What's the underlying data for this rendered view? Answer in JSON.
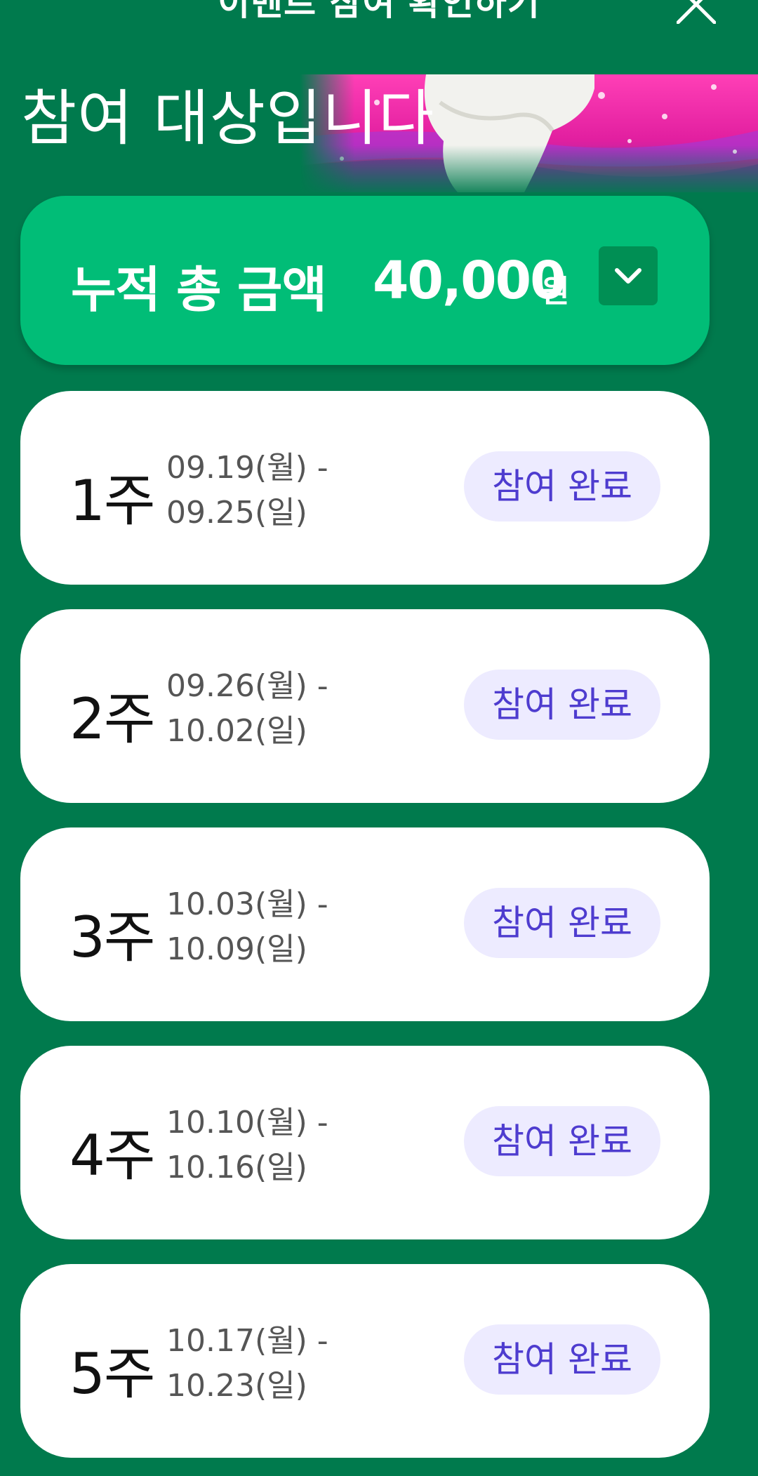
{
  "header": {
    "title": "이벤트 참여 확인하기",
    "subtitle": "참여 대상입니다"
  },
  "total": {
    "label": "누적 총 금액",
    "amount": "40,000",
    "unit": "원"
  },
  "weeks": [
    {
      "label": "1주",
      "start": "09.19(월) -",
      "end": "09.25(일)",
      "status": "참여 완료"
    },
    {
      "label": "2주",
      "start": "09.26(월) -",
      "end": "10.02(일)",
      "status": "참여 완료"
    },
    {
      "label": "3주",
      "start": "10.03(월) -",
      "end": "10.09(일)",
      "status": "참여 완료"
    },
    {
      "label": "4주",
      "start": "10.10(월) -",
      "end": "10.16(일)",
      "status": "참여 완료"
    },
    {
      "label": "5주",
      "start": "10.17(월) -",
      "end": "10.23(일)",
      "status": "참여 완료"
    }
  ],
  "icons": {
    "close": "close-icon",
    "chevron": "chevron-down-icon"
  },
  "colors": {
    "background": "#007A4D",
    "total_card": "#01BD77",
    "toggle": "#008F54",
    "status_bg": "#EDEBFF",
    "status_text": "#4E3CCF"
  }
}
